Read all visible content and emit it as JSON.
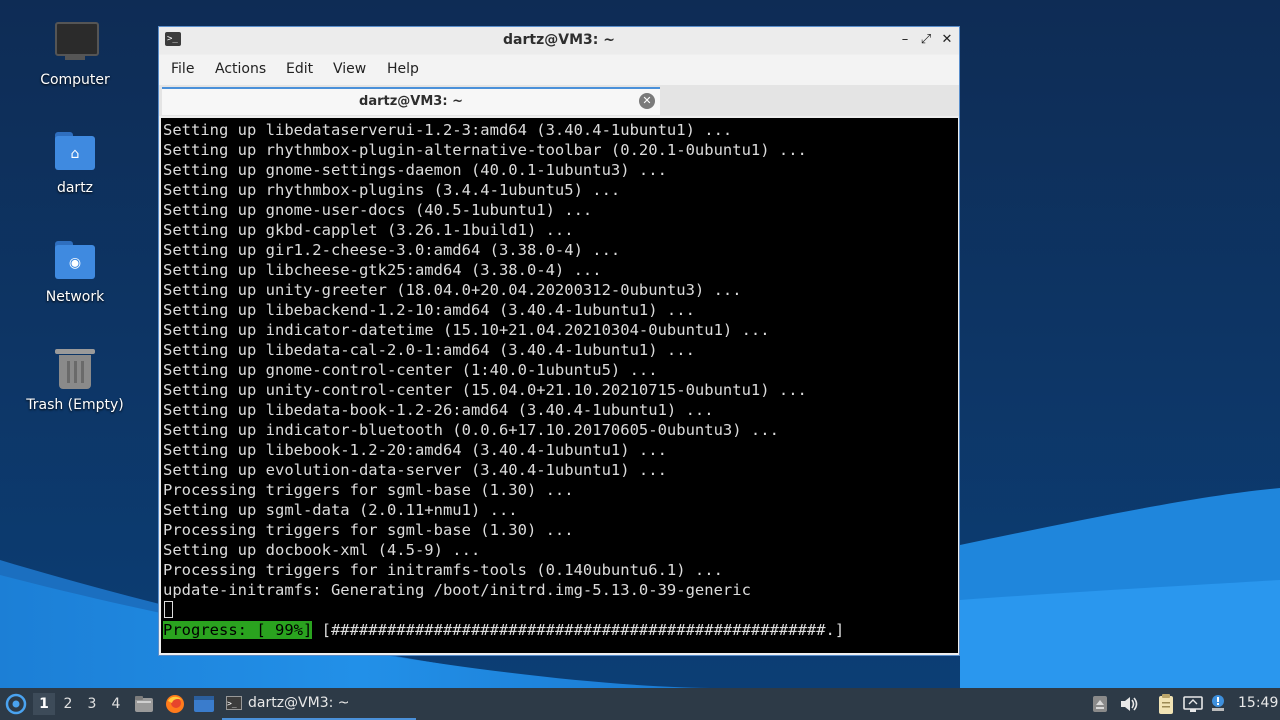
{
  "desktop": {
    "icons": [
      {
        "label": "Computer",
        "icon": "computer-icon"
      },
      {
        "label": "dartz",
        "icon": "home-folder-icon"
      },
      {
        "label": "Network",
        "icon": "network-folder-icon"
      },
      {
        "label": "Trash (Empty)",
        "icon": "trash-icon"
      }
    ]
  },
  "window": {
    "title": "dartz@VM3: ~",
    "controls": {
      "minimize": "–",
      "maximize": "⤢",
      "close": "✕"
    },
    "menu": [
      "File",
      "Actions",
      "Edit",
      "View",
      "Help"
    ],
    "tab": {
      "label": "dartz@VM3: ~",
      "close": "✕"
    }
  },
  "terminal": {
    "lines": [
      "Setting up libedataserverui-1.2-3:amd64 (3.40.4-1ubuntu1) ...",
      "Setting up rhythmbox-plugin-alternative-toolbar (0.20.1-0ubuntu1) ...",
      "Setting up gnome-settings-daemon (40.0.1-1ubuntu3) ...",
      "Setting up rhythmbox-plugins (3.4.4-1ubuntu5) ...",
      "Setting up gnome-user-docs (40.5-1ubuntu1) ...",
      "Setting up gkbd-capplet (3.26.1-1build1) ...",
      "Setting up gir1.2-cheese-3.0:amd64 (3.38.0-4) ...",
      "Setting up libcheese-gtk25:amd64 (3.38.0-4) ...",
      "Setting up unity-greeter (18.04.0+20.04.20200312-0ubuntu3) ...",
      "Setting up libebackend-1.2-10:amd64 (3.40.4-1ubuntu1) ...",
      "Setting up indicator-datetime (15.10+21.04.20210304-0ubuntu1) ...",
      "Setting up libedata-cal-2.0-1:amd64 (3.40.4-1ubuntu1) ...",
      "Setting up gnome-control-center (1:40.0-1ubuntu5) ...",
      "Setting up unity-control-center (15.04.0+21.10.20210715-0ubuntu1) ...",
      "Setting up libedata-book-1.2-26:amd64 (3.40.4-1ubuntu1) ...",
      "Setting up indicator-bluetooth (0.0.6+17.10.20170605-0ubuntu3) ...",
      "Setting up libebook-1.2-20:amd64 (3.40.4-1ubuntu1) ...",
      "Setting up evolution-data-server (3.40.4-1ubuntu1) ...",
      "Processing triggers for sgml-base (1.30) ...",
      "Setting up sgml-data (2.0.11+nmu1) ...",
      "Processing triggers for sgml-base (1.30) ...",
      "Setting up docbook-xml (4.5-9) ...",
      "Processing triggers for initramfs-tools (0.140ubuntu6.1) ...",
      "update-initramfs: Generating /boot/initrd.img-5.13.0-39-generic"
    ],
    "progress": {
      "label": "Progress: [ 99%]",
      "bar": " [#####################################################.]",
      "percent": 99
    },
    "colors": {
      "progress_bg": "#2aa31f",
      "text": "#dcdcdc",
      "background": "#000000"
    }
  },
  "taskbar": {
    "workspaces": [
      "1",
      "2",
      "3",
      "4"
    ],
    "active_workspace": "1",
    "launchers": [
      "start-menu-icon",
      "file-manager-icon",
      "firefox-icon",
      "show-desktop-icon"
    ],
    "task": {
      "label": "dartz@VM3: ~"
    },
    "tray": [
      "removable-drive-icon",
      "volume-icon",
      "clipboard-icon",
      "network-icon",
      "update-notifier-icon"
    ],
    "clock": "15:49"
  }
}
